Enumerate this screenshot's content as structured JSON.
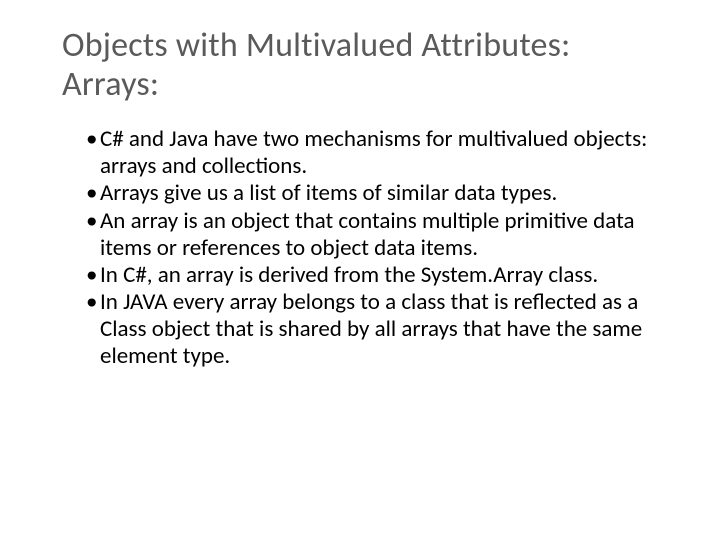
{
  "title_line1": "Objects with Multivalued Attributes:",
  "title_line2": "Arrays:",
  "bullets": {
    "b0": "C# and Java have two mechanisms for multivalued objects: arrays and collections.",
    "b1": "Arrays give us a list of items of similar data types.",
    "b2": "An array is an object that contains multiple primitive data items or references to object data items.",
    "b3": "In C#, an array is derived from the System.Array class.",
    "b4": "In JAVA every array belongs to a class that is reflected as a Class object that is shared by all arrays that have the same element type."
  }
}
